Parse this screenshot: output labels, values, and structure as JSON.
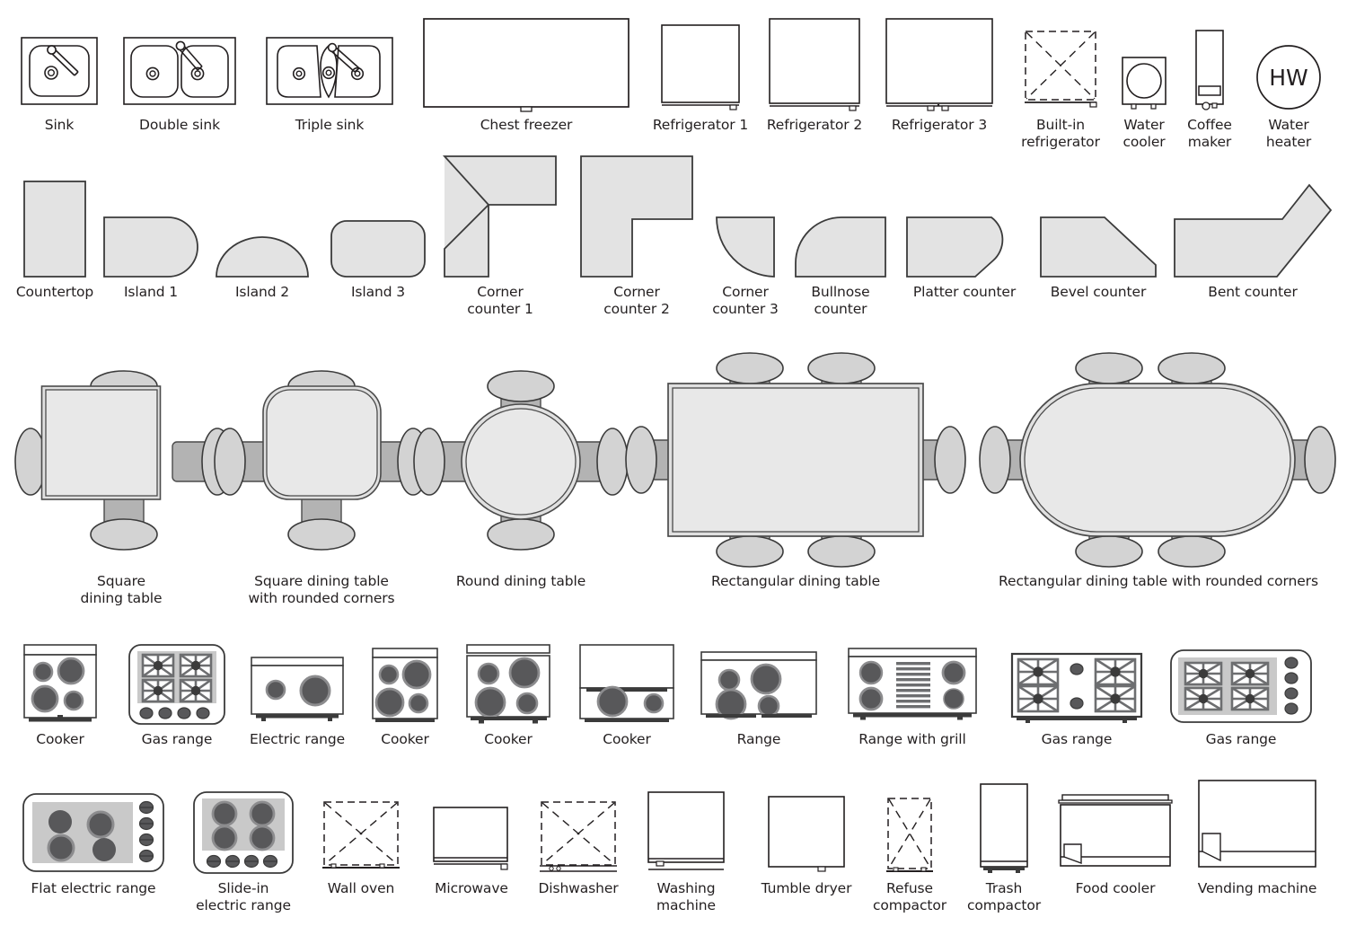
{
  "palette": {
    "stroke": "#231f20",
    "line": "#3b3b3b",
    "fill_light": "#e3e3e3",
    "fill_table": "#e8e8e8",
    "chair_back": "#d3d3d3",
    "chair_body": "#b3b3b3",
    "burner_dark": "#58585a",
    "burner_mid": "#8c8c8e",
    "grate": "#6d6e70",
    "panel_gray": "#c9c9c9",
    "background": "#ffffff",
    "text": "#231f20"
  },
  "rows": [
    {
      "name": "sinks-refrigeration",
      "items": [
        {
          "id": "sink",
          "label": "Sink"
        },
        {
          "id": "double-sink",
          "label": "Double sink"
        },
        {
          "id": "triple-sink",
          "label": "Triple sink"
        },
        {
          "id": "chest-freezer",
          "label": "Chest freezer"
        },
        {
          "id": "refrigerator-1",
          "label": "Refrigerator 1"
        },
        {
          "id": "refrigerator-2",
          "label": "Refrigerator 2"
        },
        {
          "id": "refrigerator-3",
          "label": "Refrigerator 3"
        },
        {
          "id": "built-in-refrigerator",
          "label": "Built-in\nrefrigerator"
        },
        {
          "id": "water-cooler",
          "label": "Water\ncooler"
        },
        {
          "id": "coffee-maker",
          "label": "Coffee\nmaker"
        },
        {
          "id": "water-heater",
          "label": "Water\nheater",
          "glyph": "HW"
        }
      ]
    },
    {
      "name": "counters",
      "items": [
        {
          "id": "countertop",
          "label": "Countertop"
        },
        {
          "id": "island-1",
          "label": "Island 1"
        },
        {
          "id": "island-2",
          "label": "Island 2"
        },
        {
          "id": "island-3",
          "label": "Island 3"
        },
        {
          "id": "corner-counter-1",
          "label": "Corner\ncounter 1"
        },
        {
          "id": "corner-counter-2",
          "label": "Corner\ncounter 2"
        },
        {
          "id": "corner-counter-3",
          "label": "Corner\ncounter 3"
        },
        {
          "id": "bullnose-counter",
          "label": "Bullnose\ncounter"
        },
        {
          "id": "platter-counter",
          "label": "Platter counter"
        },
        {
          "id": "bevel-counter",
          "label": "Bevel counter"
        },
        {
          "id": "bent-counter",
          "label": "Bent counter"
        }
      ]
    },
    {
      "name": "dining-tables",
      "items": [
        {
          "id": "square-dining-table",
          "label": "Square\ndining table"
        },
        {
          "id": "square-dining-table-rounded",
          "label": "Square dining table\nwith rounded corners"
        },
        {
          "id": "round-dining-table",
          "label": "Round dining table"
        },
        {
          "id": "rectangular-dining-table",
          "label": "Rectangular dining table"
        },
        {
          "id": "rectangular-dining-table-rounded",
          "label": "Rectangular dining table with rounded corners"
        }
      ]
    },
    {
      "name": "cookers-ranges",
      "items": [
        {
          "id": "cooker-1",
          "label": "Cooker"
        },
        {
          "id": "gas-range-1",
          "label": "Gas range"
        },
        {
          "id": "electric-range",
          "label": "Electric range"
        },
        {
          "id": "cooker-2",
          "label": "Cooker"
        },
        {
          "id": "cooker-3",
          "label": "Cooker"
        },
        {
          "id": "cooker-4",
          "label": "Cooker"
        },
        {
          "id": "range",
          "label": "Range"
        },
        {
          "id": "range-with-grill",
          "label": "Range with grill"
        },
        {
          "id": "gas-range-2",
          "label": "Gas range"
        },
        {
          "id": "gas-range-3",
          "label": "Gas range"
        }
      ]
    },
    {
      "name": "appliances",
      "items": [
        {
          "id": "flat-electric-range",
          "label": "Flat electric range"
        },
        {
          "id": "slide-in-electric-range",
          "label": "Slide-in\nelectric range"
        },
        {
          "id": "wall-oven",
          "label": "Wall oven"
        },
        {
          "id": "microwave",
          "label": "Microwave"
        },
        {
          "id": "dishwasher",
          "label": "Dishwasher"
        },
        {
          "id": "washing-machine",
          "label": "Washing\nmachine"
        },
        {
          "id": "tumble-dryer",
          "label": "Tumble dryer"
        },
        {
          "id": "refuse-compactor",
          "label": "Refuse\ncompactor"
        },
        {
          "id": "trash-compactor",
          "label": "Trash\ncompactor"
        },
        {
          "id": "food-cooler",
          "label": "Food cooler"
        },
        {
          "id": "vending-machine",
          "label": "Vending machine"
        }
      ]
    }
  ]
}
